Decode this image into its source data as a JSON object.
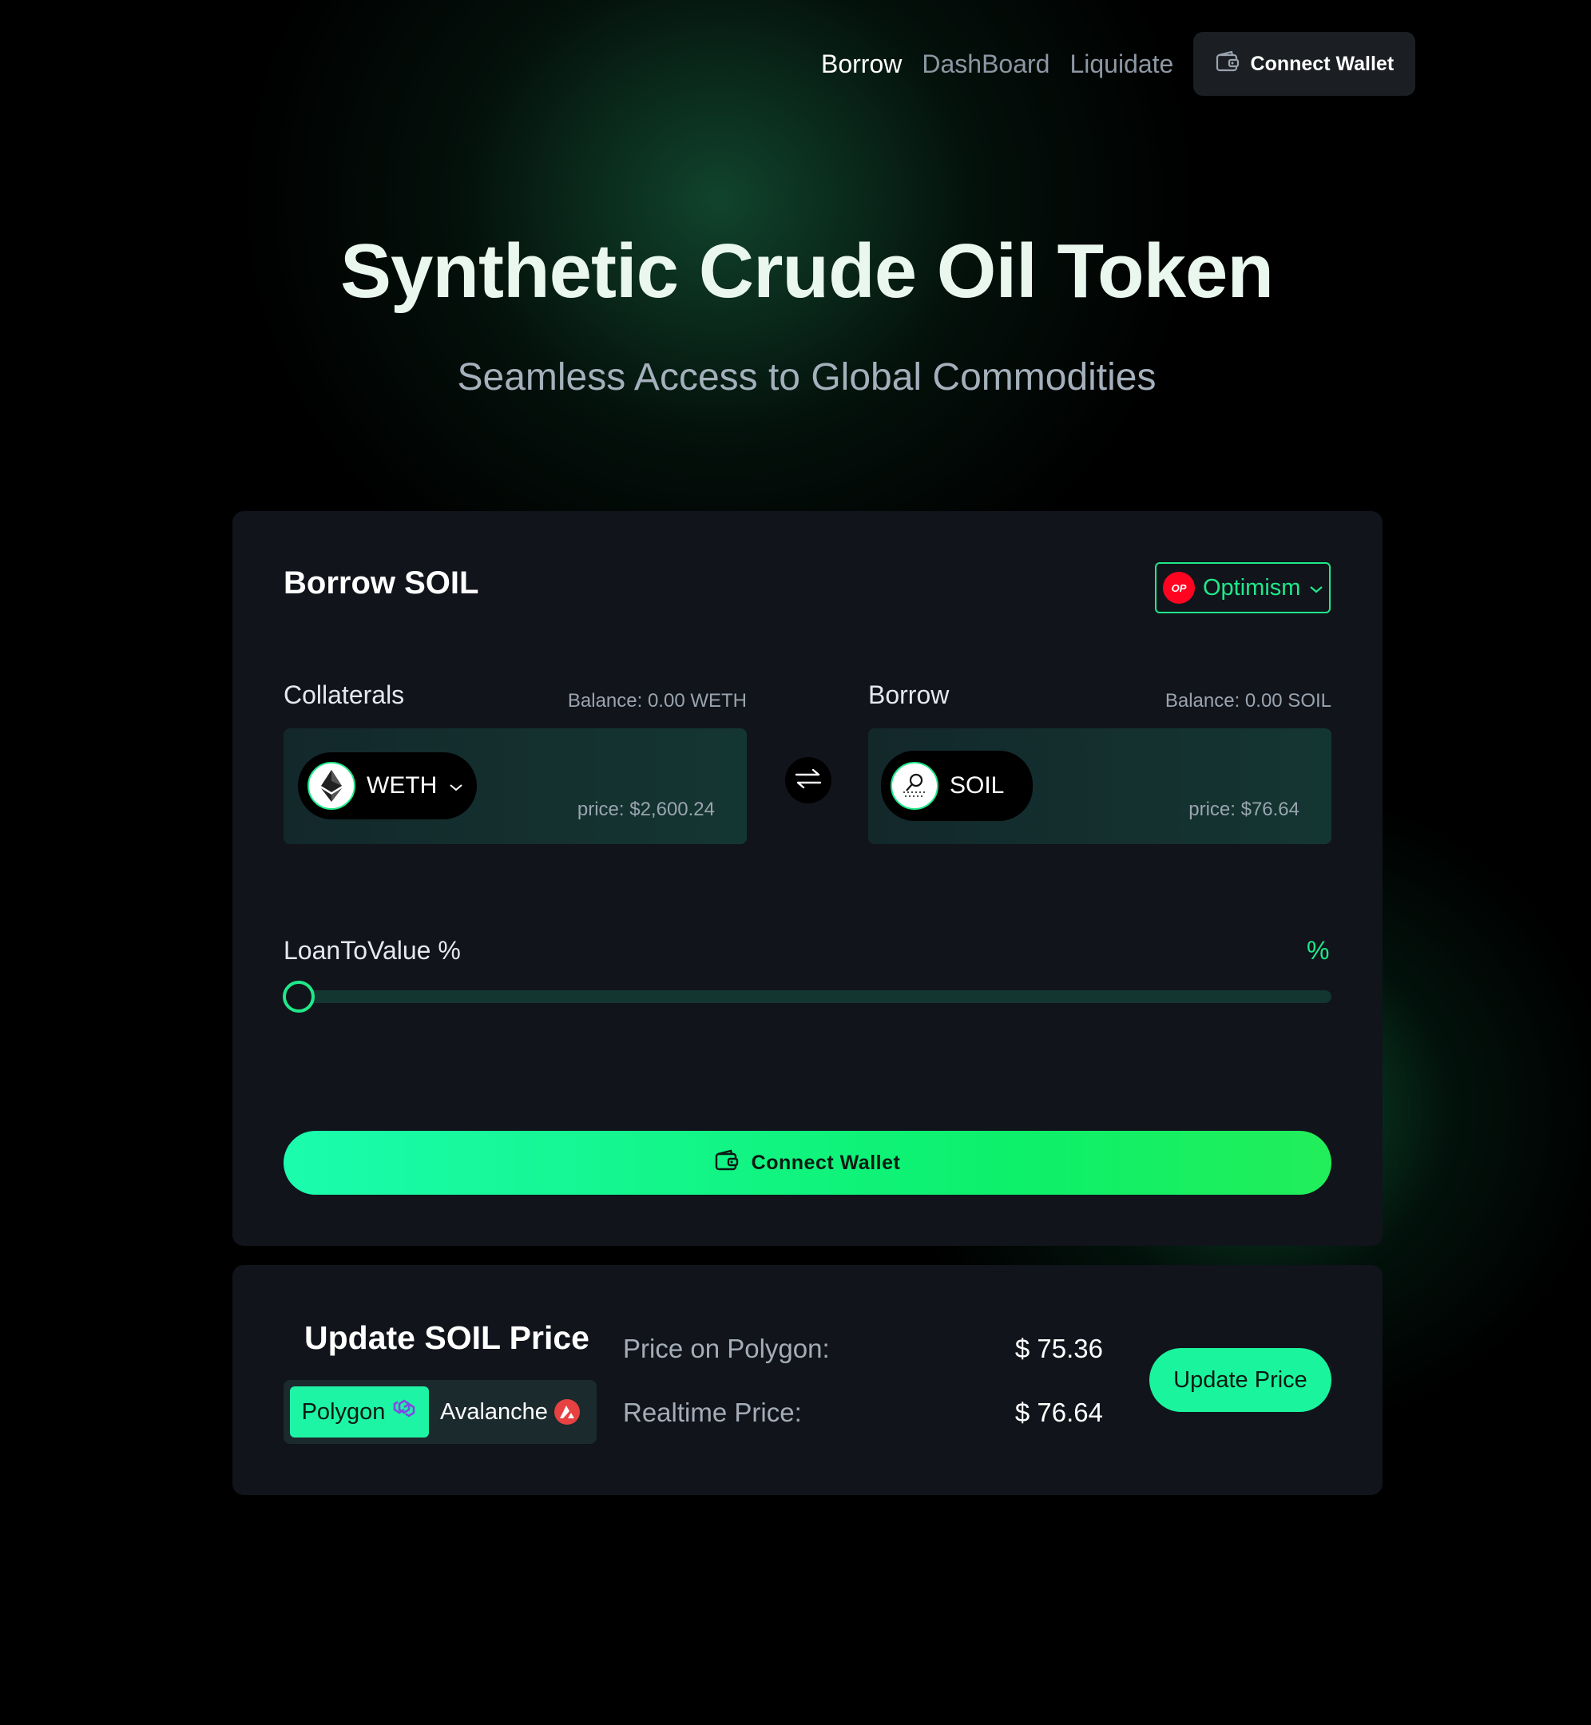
{
  "nav": {
    "items": [
      "Borrow",
      "DashBoard",
      "Liquidate"
    ],
    "active": "Borrow",
    "connect_wallet": "Connect Wallet"
  },
  "hero": {
    "title": "Synthetic Crude Oil Token",
    "subtitle": "Seamless Access to Global Commodities"
  },
  "borrow_card": {
    "title": "Borrow SOIL",
    "network": {
      "label": "Optimism",
      "badge": "OP",
      "icon": "optimism-icon"
    },
    "collateral": {
      "label": "Collaterals",
      "balance": "Balance: 0.00 WETH",
      "token": "WETH",
      "token_icon": "ethereum-icon",
      "price": "price: $2,600.24"
    },
    "borrow": {
      "label": "Borrow",
      "balance": "Balance: 0.00 SOIL",
      "token": "SOIL",
      "token_icon": "soil-icon",
      "price": "price: $76.64"
    },
    "ltv": {
      "label": "LoanToValue %",
      "value_display": "%",
      "slider_value": 0
    },
    "connect_wallet": "Connect Wallet"
  },
  "update_card": {
    "title": "Update SOIL Price",
    "tabs": [
      {
        "label": "Polygon",
        "icon": "polygon-icon",
        "active": true
      },
      {
        "label": "Avalanche",
        "icon": "avalanche-icon",
        "active": false
      }
    ],
    "rows": [
      {
        "label": "Price on Polygon:",
        "value": "$ 75.36"
      },
      {
        "label": "Realtime Price:",
        "value": "$ 76.64"
      }
    ],
    "button": "Update Price"
  },
  "colors": {
    "accent": "#1fe98a",
    "background": "#000000",
    "card": "#11141b",
    "op_red": "#ff0420",
    "avalanche_red": "#e84142"
  }
}
